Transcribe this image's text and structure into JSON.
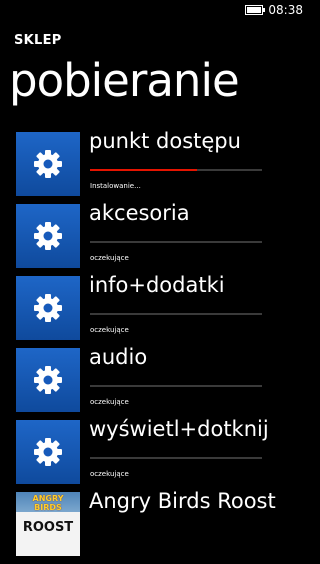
{
  "status_bar": {
    "time": "08:38",
    "battery_icon": "battery-icon"
  },
  "app_title": "SKLEP",
  "page_title": "pobieranie",
  "colors": {
    "tile": "#1b5fbf",
    "progress": "#e51400",
    "background": "#000000"
  },
  "queue": [
    {
      "name": "punkt dostępu",
      "status": "Instalowanie...",
      "progress": 0.62,
      "icon": "gear-icon"
    },
    {
      "name": "akcesoria",
      "status": "oczekujące",
      "progress": 0,
      "icon": "gear-icon"
    },
    {
      "name": "info+dodatki",
      "status": "oczekujące",
      "progress": 0,
      "icon": "gear-icon"
    },
    {
      "name": "audio",
      "status": "oczekujące",
      "progress": 0,
      "icon": "gear-icon"
    },
    {
      "name": "wyświetl+dotknij",
      "status": "oczekujące",
      "progress": 0,
      "icon": "gear-icon"
    },
    {
      "name": "Angry Birds Roost",
      "status": "",
      "progress": 0,
      "icon": "angry-birds-thumbnail",
      "thumb_text": [
        "ANGRY BIRDS",
        "ROOST"
      ]
    }
  ]
}
